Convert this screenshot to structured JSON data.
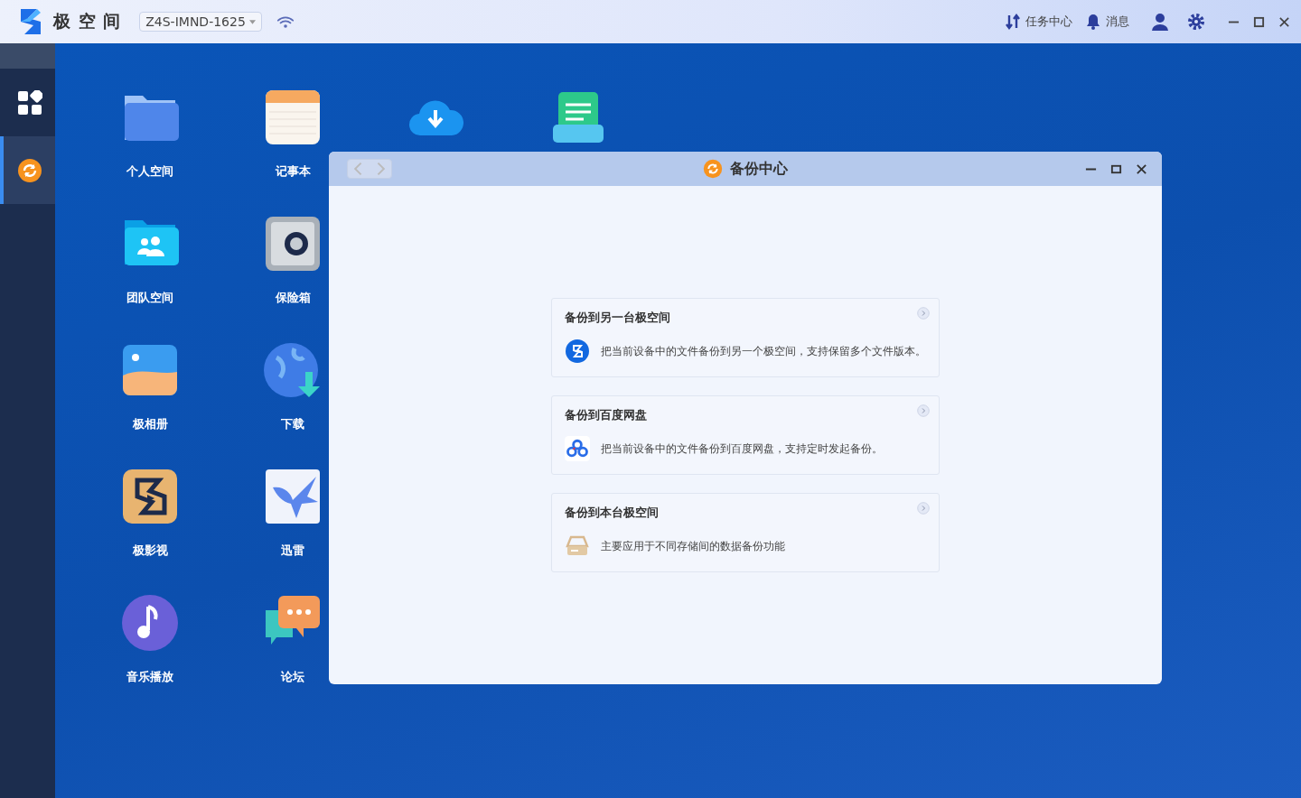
{
  "topbar": {
    "brand": "极 空 间",
    "device": "Z4S-IMND-1625",
    "actions": [
      {
        "label": "任务中心"
      },
      {
        "label": "消息"
      }
    ]
  },
  "sidebar": {
    "items": [
      {
        "selected": false
      },
      {
        "selected": true
      }
    ]
  },
  "desktop_icons": [
    {
      "label": "个人空间"
    },
    {
      "label": "记事本"
    },
    {
      "label": "团队空间"
    },
    {
      "label": "保险箱"
    },
    {
      "label": "极相册"
    },
    {
      "label": "下载"
    },
    {
      "label": "极影视"
    },
    {
      "label": "迅雷"
    },
    {
      "label": "音乐播放"
    },
    {
      "label": "论坛"
    }
  ],
  "window": {
    "title": "备份中心",
    "cards": [
      {
        "title": "备份到另一台极空间",
        "description": "把当前设备中的文件备份到另一个极空间，支持保留多个文件版本。"
      },
      {
        "title": "备份到百度网盘",
        "description": "把当前设备中的文件备份到百度网盘，支持定时发起备份。"
      },
      {
        "title": "备份到本台极空间",
        "description": "主要应用于不同存储间的数据备份功能"
      }
    ]
  }
}
